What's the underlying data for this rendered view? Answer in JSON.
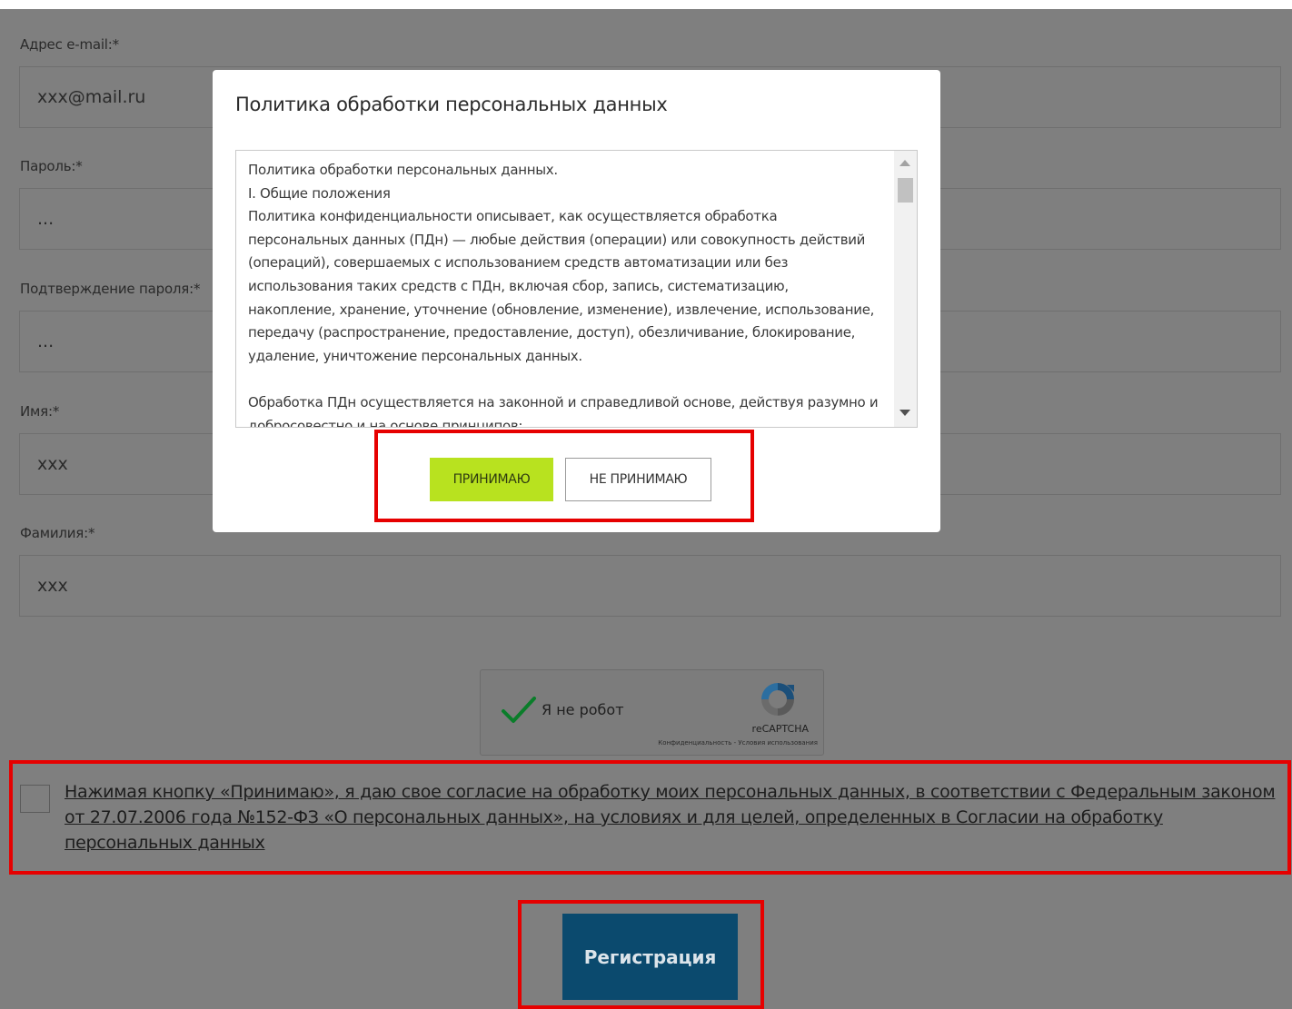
{
  "form": {
    "email": {
      "label": "Адрес e-mail:*",
      "value": "xxx@mail.ru"
    },
    "password": {
      "label": "Пароль:*",
      "value": "..."
    },
    "password_confirm": {
      "label": "Подтверждение пароля:*",
      "value": "..."
    },
    "first_name": {
      "label": "Имя:*",
      "value": "xxx"
    },
    "last_name": {
      "label": "Фамилия:*",
      "value": "xxx"
    },
    "submit_label": "Регистрация"
  },
  "captcha": {
    "label": "Я не робот",
    "brand": "reCAPTCHA",
    "terms": "Конфиденциальность - Условия использования",
    "checked": true
  },
  "consent": {
    "text": "Нажимая кнопку «Принимаю», я даю свое согласие на обработку моих персональных данных, в соответствии с Федеральным законом от 27.07.2006 года №152-ФЗ «О персональных данных», на условиях и для целей, определенных в Согласии на обработку персональных данных"
  },
  "modal": {
    "title": "Политика обработки персональных данных",
    "policy_lines": [
      "Политика обработки персональных данных.",
      "I. Общие положения",
      "Политика конфиденциальности описывает, как осуществляется обработка персональных данных (ПДн) — любые действия (операции) или совокупность действий (операций), совершаемых с использованием средств автоматизации или без использования таких средств с ПДн, включая сбор, запись, систематизацию, накопление, хранение, уточнение (обновление, изменение), извлечение, использование, передачу (распространение, предоставление, доступ), обезличивание, блокирование, удаление, уничтожение персональных данных.",
      "",
      "Обработка ПДн осуществляется на законной и справедливой основе, действуя разумно и добросовестно и на основе принципов:"
    ],
    "accept_label": "ПРИНИМАЮ",
    "decline_label": "НЕ ПРИНИМАЮ"
  },
  "colors": {
    "overlay": "#7f7f7f",
    "accept": "#b8e21f",
    "submit": "#0b4a6e",
    "highlight": "#e60000"
  }
}
